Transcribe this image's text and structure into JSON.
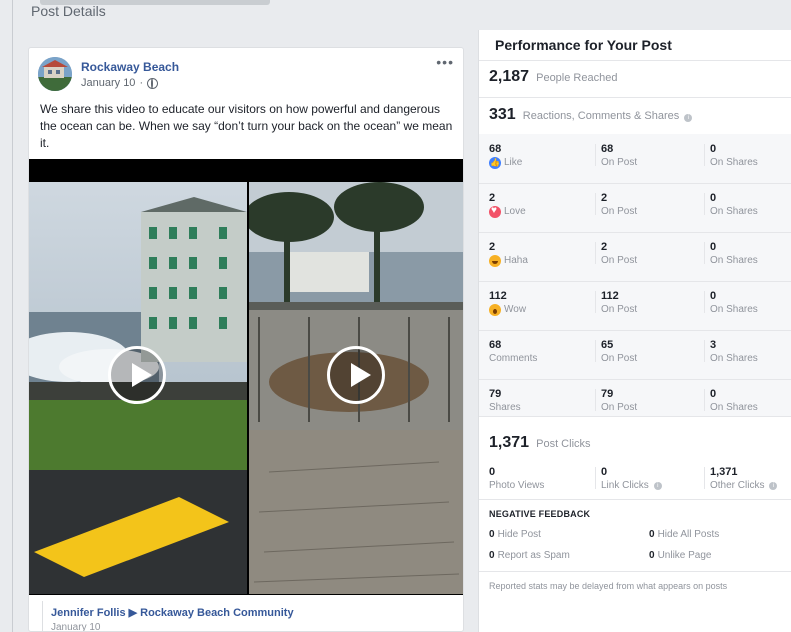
{
  "page": {
    "header_title": "Post Details"
  },
  "post": {
    "page_name": "Rockaway Beach",
    "date": "January 10",
    "more": "•••",
    "text": "We share this video to educate our visitors on how powerful and dangerous the ocean can be. When we say “don’t turn your back on the ocean” we mean it.",
    "comment": {
      "author": "Jennifer Follis ▶ Rockaway Beach Community",
      "date": "January 10"
    }
  },
  "performance": {
    "title": "Performance for Your Post",
    "reached": {
      "value": "2,187",
      "label": "People Reached"
    },
    "reactions": {
      "value": "331",
      "label": "Reactions, Comments & Shares"
    },
    "rows": [
      {
        "total": "68",
        "label": "Like",
        "icon": "like-icon",
        "on_post": "68",
        "on_post_label": "On Post",
        "on_shares": "0",
        "on_shares_label": "On Shares"
      },
      {
        "total": "2",
        "label": "Love",
        "icon": "love-icon",
        "on_post": "2",
        "on_post_label": "On Post",
        "on_shares": "0",
        "on_shares_label": "On Shares"
      },
      {
        "total": "2",
        "label": "Haha",
        "icon": "haha-icon",
        "on_post": "2",
        "on_post_label": "On Post",
        "on_shares": "0",
        "on_shares_label": "On Shares"
      },
      {
        "total": "112",
        "label": "Wow",
        "icon": "wow-icon",
        "on_post": "112",
        "on_post_label": "On Post",
        "on_shares": "0",
        "on_shares_label": "On Shares"
      },
      {
        "total": "68",
        "label": "Comments",
        "icon": "",
        "on_post": "65",
        "on_post_label": "On Post",
        "on_shares": "3",
        "on_shares_label": "On Shares"
      },
      {
        "total": "79",
        "label": "Shares",
        "icon": "",
        "on_post": "79",
        "on_post_label": "On Post",
        "on_shares": "0",
        "on_shares_label": "On Shares"
      }
    ],
    "clicks": {
      "value": "1,371",
      "label": "Post Clicks"
    },
    "click_breakdown": [
      {
        "value": "0",
        "label": "Photo Views"
      },
      {
        "value": "0",
        "label": "Link Clicks"
      },
      {
        "value": "1,371",
        "label": "Other Clicks"
      }
    ],
    "negative": {
      "title": "NEGATIVE FEEDBACK",
      "items": [
        {
          "value": "0",
          "label": "Hide Post"
        },
        {
          "value": "0",
          "label": "Hide All Posts"
        },
        {
          "value": "0",
          "label": "Report as Spam"
        },
        {
          "value": "0",
          "label": "Unlike Page"
        }
      ]
    },
    "footnote": "Reported stats may be delayed from what appears on posts"
  }
}
